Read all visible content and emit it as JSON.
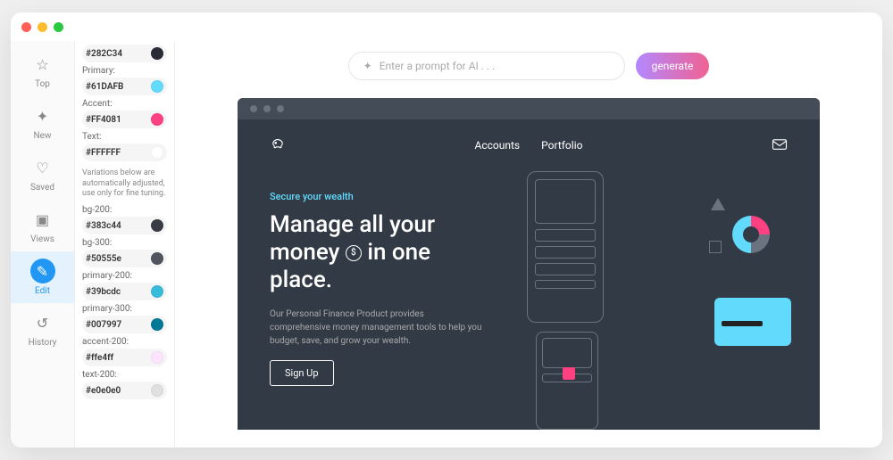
{
  "rail": [
    {
      "id": "top",
      "label": "Top"
    },
    {
      "id": "new",
      "label": "New"
    },
    {
      "id": "saved",
      "label": "Saved"
    },
    {
      "id": "views",
      "label": "Views"
    },
    {
      "id": "edit",
      "label": "Edit"
    },
    {
      "id": "history",
      "label": "History"
    }
  ],
  "colors": {
    "bg": {
      "label": "",
      "value": "#282C34",
      "hex": "#282C34"
    },
    "primary": {
      "label": "Primary:",
      "value": "#61DAFB",
      "hex": "#61DAFB"
    },
    "accent": {
      "label": "Accent:",
      "value": "#FF4081",
      "hex": "#FF4081"
    },
    "text": {
      "label": "Text:",
      "value": "#FFFFFF",
      "hex": "#FFFFFF"
    }
  },
  "note": "Variations below are automatically adjusted, use only for fine tuning.",
  "variations": [
    {
      "label": "bg-200:",
      "value": "#383c44",
      "hex": "#383c44"
    },
    {
      "label": "bg-300:",
      "value": "#50555e",
      "hex": "#50555e"
    },
    {
      "label": "primary-200:",
      "value": "#39bcdc",
      "hex": "#39bcdc"
    },
    {
      "label": "primary-300:",
      "value": "#007997",
      "hex": "#007997"
    },
    {
      "label": "accent-200:",
      "value": "#ffe4ff",
      "hex": "#ffe4ff"
    },
    {
      "label": "text-200:",
      "value": "#e0e0e0",
      "hex": "#e0e0e0"
    }
  ],
  "prompt": {
    "placeholder": "Enter a prompt for AI . . .",
    "button": "generate"
  },
  "site": {
    "nav": {
      "item1": "Accounts",
      "item2": "Portfolio"
    },
    "eyebrow": "Secure your wealth",
    "title_l1": "Manage all your",
    "title_l2a": "money",
    "title_l2b": "in one",
    "title_l3": "place.",
    "desc": "Our Personal Finance Product provides comprehensive money management tools to help you budget, save, and grow your wealth.",
    "cta": "Sign Up"
  }
}
